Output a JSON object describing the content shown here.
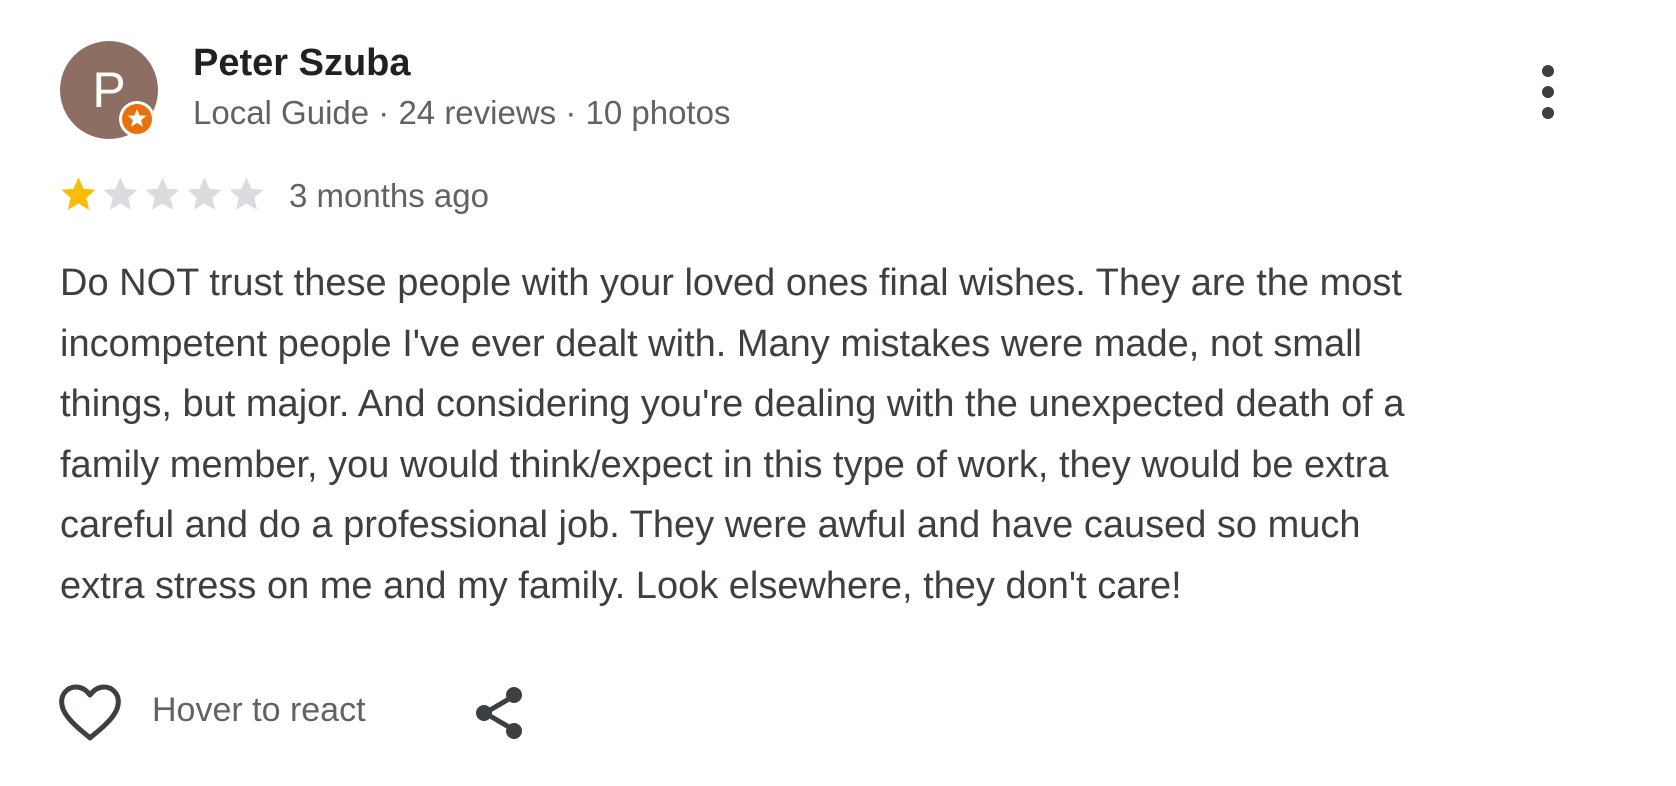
{
  "reviewer": {
    "avatar_letter": "P",
    "avatar_color": "#8d6e63",
    "badge_icon": "local-guide-star-badge",
    "badge_color": "#e8710a",
    "name": "Peter Szuba",
    "meta": "Local Guide · 24 reviews · 10 photos"
  },
  "more_options_icon": "vertical-dots-icon",
  "rating": {
    "value": 1,
    "max": 5,
    "filled_color": "#fbbc04",
    "empty_color": "#dadce0"
  },
  "time_ago": "3 months ago",
  "review_text": {
    "lines": [
      "Do NOT trust these people with your loved ones final wishes. They are the most",
      "incompetent people I've ever dealt with. Many mistakes were made, not small",
      "things, but major. And considering you're dealing with the unexpected death of a",
      "family member, you would think/expect in this type of work, they would be extra",
      "careful and do a professional job. They were awful and have caused so much",
      "extra stress on me and my family. Look elsewhere, they don't care!"
    ]
  },
  "actions": {
    "like_icon": "heart-outline-icon",
    "react_label": "Hover to react",
    "share_icon": "share-icon"
  }
}
